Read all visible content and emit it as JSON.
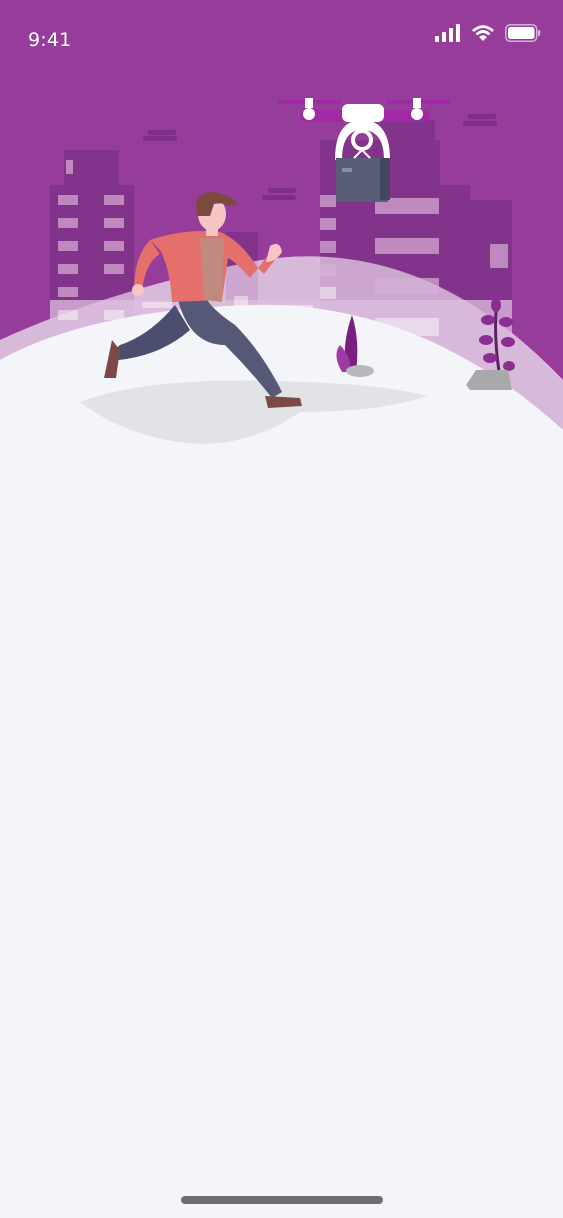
{
  "status_bar": {
    "time": "9:41",
    "signal_icon": "cellular-signal-icon",
    "wifi_icon": "wifi-icon",
    "battery_icon": "battery-icon"
  },
  "hero": {
    "illustration": "drone-delivery-illustration"
  },
  "colors": {
    "brand_purple": "#963c9a",
    "background": "#f4f5f8",
    "home_indicator": "#6e6e72"
  }
}
